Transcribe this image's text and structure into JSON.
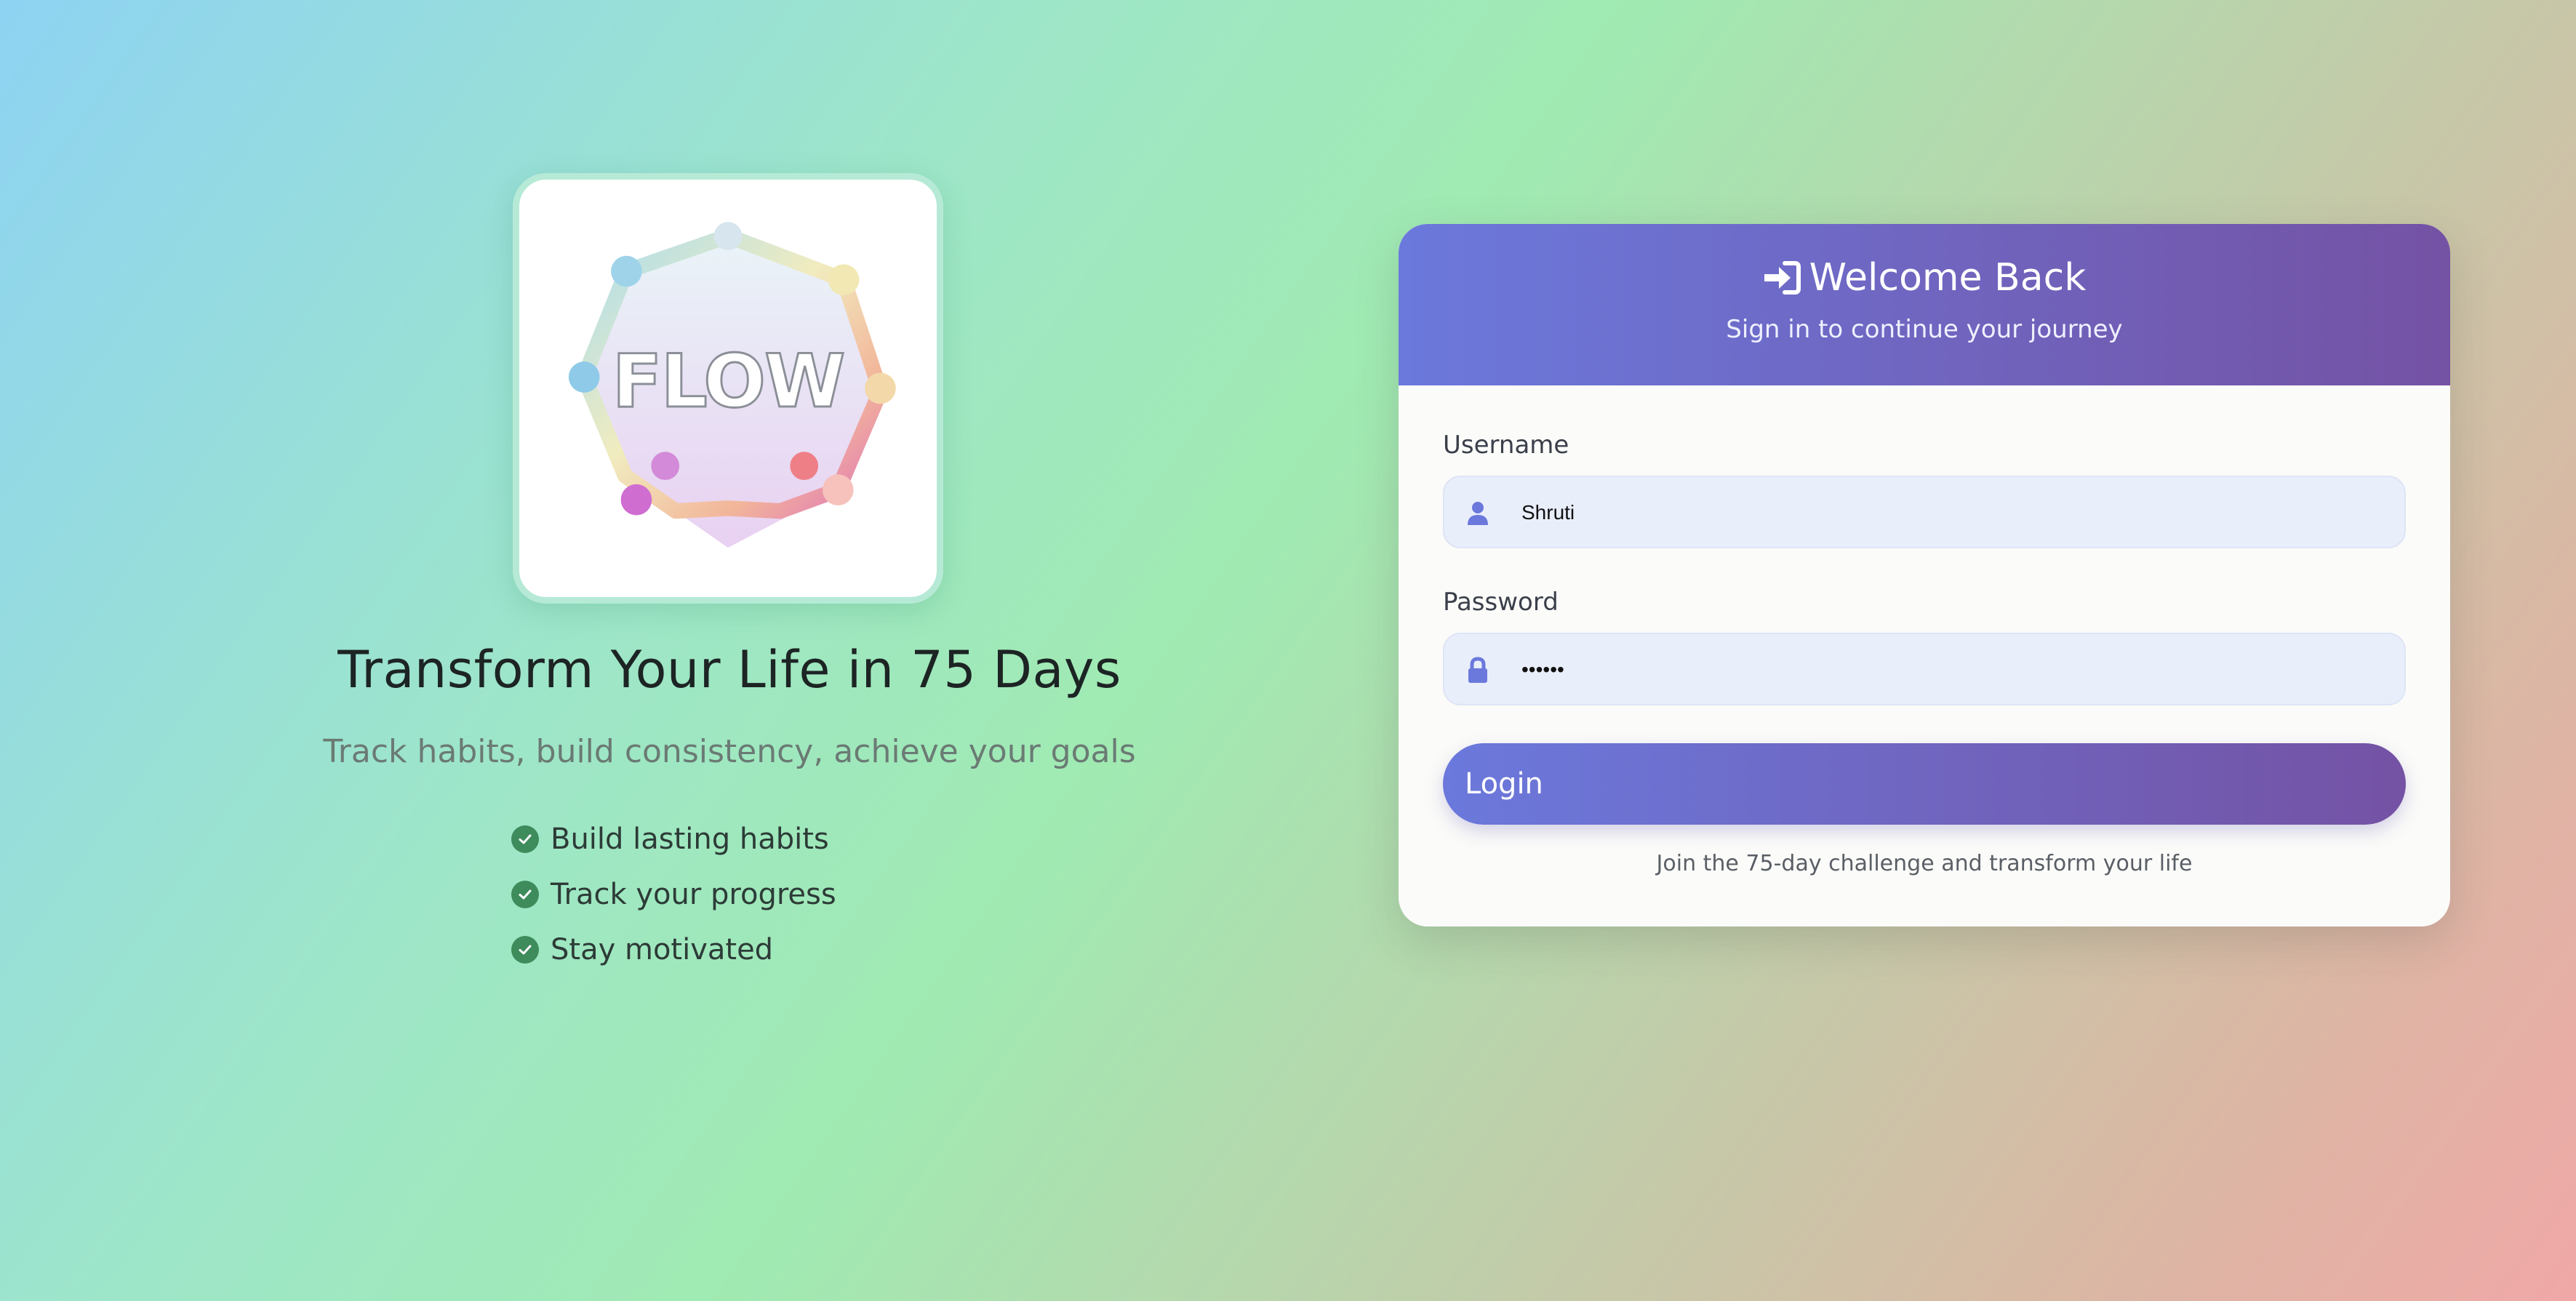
{
  "logo": {
    "text": "FLOW",
    "icon": "flow-logo-icon"
  },
  "hero": {
    "title": "Transform Your Life in 75 Days",
    "subtitle": "Track habits, build consistency, achieve your goals",
    "features": [
      "Build lasting habits",
      "Track your progress",
      "Stay motivated"
    ]
  },
  "login": {
    "header_title": "Welcome Back",
    "header_subtitle": "Sign in to continue your journey",
    "username_label": "Username",
    "username_value": "Shruti",
    "password_label": "Password",
    "password_value": "••••••",
    "button_label": "Login",
    "footer_text": "Join the 75-day challenge and transform your life"
  },
  "icons": {
    "header": "sign-in-icon",
    "username": "user-icon",
    "password": "lock-icon",
    "feature": "check-circle-icon"
  },
  "colors": {
    "accent_start": "#6b79dc",
    "accent_end": "#7452a4",
    "check": "#3e8b5c",
    "input_bg": "#e9eefb"
  }
}
